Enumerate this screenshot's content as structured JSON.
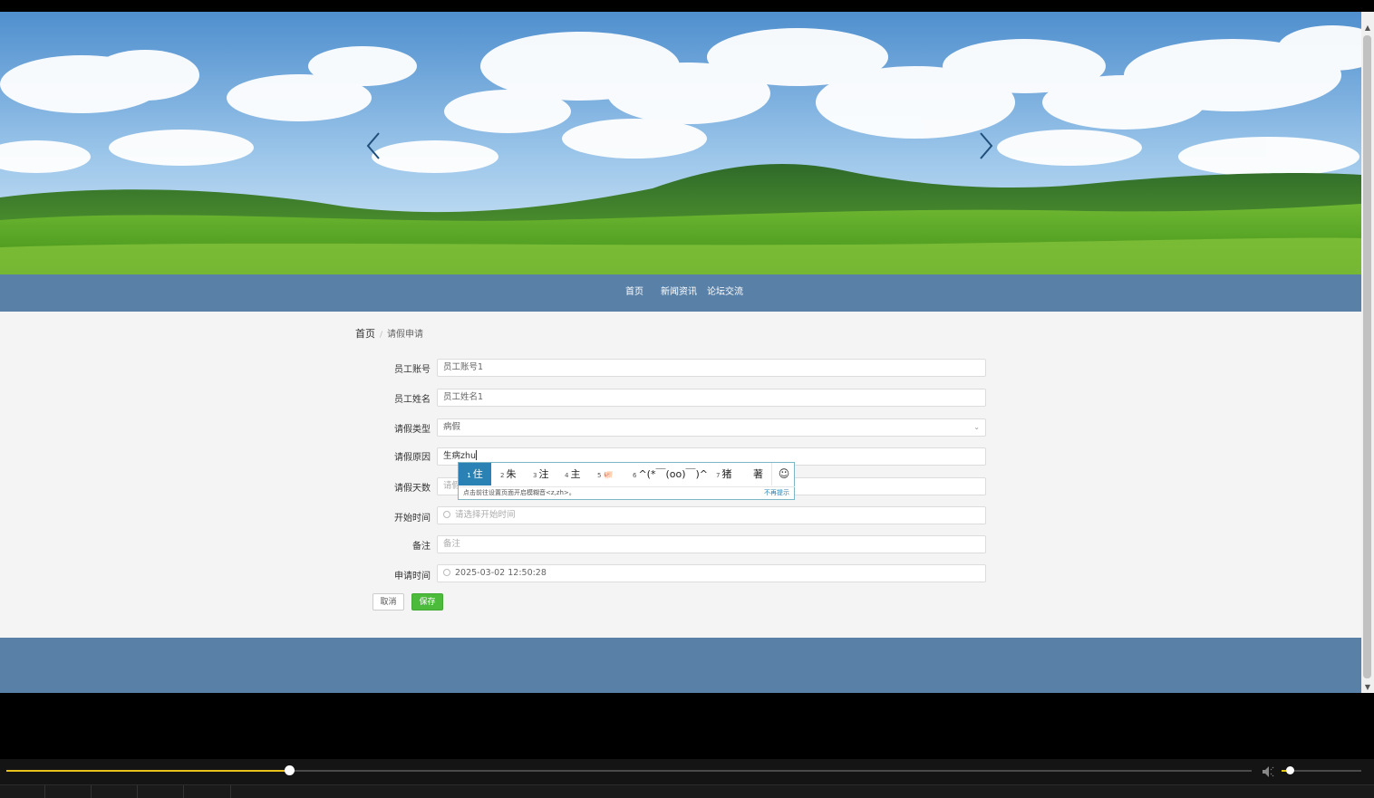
{
  "nav": {
    "items": [
      "首页",
      "新闻资讯",
      "论坛交流"
    ]
  },
  "breadcrumb": {
    "home": "首页",
    "separator": "/",
    "current": "请假申请"
  },
  "form": {
    "employee_account": {
      "label": "员工账号",
      "value": "员工账号1"
    },
    "employee_name": {
      "label": "员工姓名",
      "value": "员工姓名1"
    },
    "leave_type": {
      "label": "请假类型",
      "value": "病假"
    },
    "leave_reason": {
      "label": "请假原因",
      "value": "生病zhu"
    },
    "leave_days": {
      "label": "请假天数",
      "placeholder": "请假天数"
    },
    "start_time": {
      "label": "开始时间",
      "placeholder": "请选择开始时间"
    },
    "remark": {
      "label": "备注",
      "placeholder": "备注"
    },
    "apply_time": {
      "label": "申请时间",
      "value": "2025-03-02 12:50:28"
    }
  },
  "buttons": {
    "cancel": "取消",
    "save": "保存"
  },
  "ime": {
    "candidates": [
      {
        "n": "1",
        "text": "住"
      },
      {
        "n": "2",
        "text": "朱"
      },
      {
        "n": "3",
        "text": "注"
      },
      {
        "n": "4",
        "text": "主"
      },
      {
        "n": "5",
        "text": "🐖"
      },
      {
        "n": "6",
        "text": "^(*￣(oo)￣)^"
      },
      {
        "n": "7",
        "text": "猪"
      },
      {
        "n": "",
        "text": "著"
      }
    ],
    "hint": "点击前往设置页面开启模糊音<z,zh>。",
    "dismiss": "不再提示",
    "emoji_icon": "smiley-icon"
  },
  "player": {
    "progress": 0.227,
    "volume": 0.1
  },
  "colors": {
    "nav_bg": "#5981a8",
    "save_btn": "#4cbb3c",
    "ime_selected": "#2a82b4",
    "progress": "#e8c21b"
  }
}
